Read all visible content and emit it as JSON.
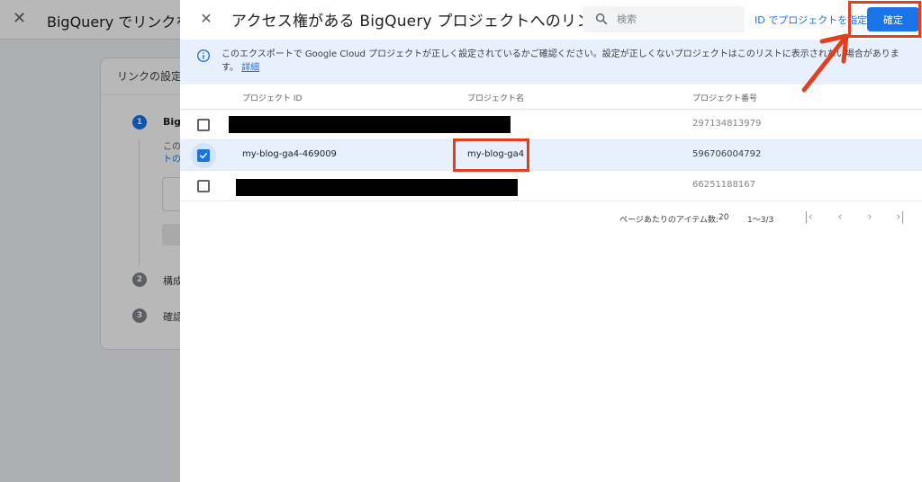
{
  "background": {
    "title": "BigQuery でリンクを",
    "card_title": "リンクの設定",
    "steps": [
      {
        "num": "1",
        "label": "BigQ"
      },
      {
        "num": "2",
        "label": "構成"
      },
      {
        "num": "3",
        "label": "確認"
      }
    ],
    "card_text_line1": "この",
    "card_text_line2": "トの"
  },
  "dialog": {
    "title": "アクセス権がある BigQuery プロジェクトへのリンク",
    "search_placeholder": "検索",
    "id_link": "ID でプロジェクトを指定",
    "confirm_label": "確定",
    "banner_text": "このエクスポートで Google Cloud プロジェクトが正しく設定されているかご確認ください。設定が正しくないプロジェクトはこのリストに表示されない場合があります。",
    "banner_link": "詳細"
  },
  "table": {
    "columns": [
      "プロジェクト ID",
      "プロジェクト名",
      "プロジェクト番号"
    ],
    "rows": [
      {
        "project_id": "",
        "project_name": "",
        "project_number": "297134813979",
        "checked": false,
        "redacted": true
      },
      {
        "project_id": "my-blog-ga4-469009",
        "project_name": "my-blog-ga4",
        "project_number": "596706004792",
        "checked": true,
        "redacted": false
      },
      {
        "project_id": "",
        "project_name": "",
        "project_number": "66251188167",
        "checked": false,
        "redacted": true
      }
    ]
  },
  "pagination": {
    "items_per_page_label": "ページあたりのアイテム数:",
    "items_per_page": "20",
    "range": "1〜3/3"
  },
  "colors": {
    "accent": "#1a73e8",
    "annotation": "#e0401f",
    "banner_bg": "#e8f0fe"
  }
}
